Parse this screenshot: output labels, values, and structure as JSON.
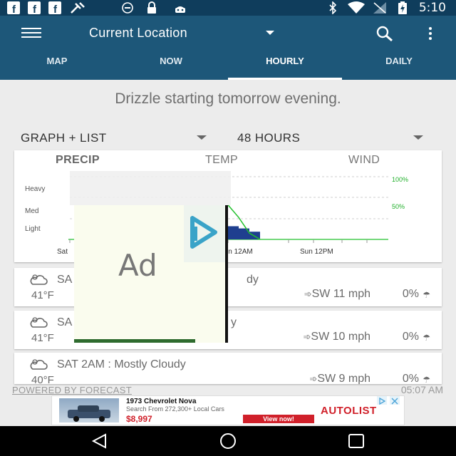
{
  "status_bar": {
    "time": "5:10",
    "left_icons": [
      "facebook-icon",
      "facebook-icon",
      "facebook-icon",
      "tool-icon",
      "info-icon",
      "lock-icon",
      "android-icon"
    ],
    "right_icons": [
      "bluetooth-icon",
      "wifi-icon",
      "signal-icon",
      "battery-charging-icon"
    ]
  },
  "app_bar": {
    "title": "Current Location",
    "color": "#1d5779"
  },
  "tabs": [
    {
      "label": "MAP",
      "active": false
    },
    {
      "label": "NOW",
      "active": false
    },
    {
      "label": "HOURLY",
      "active": true
    },
    {
      "label": "DAILY",
      "active": false
    }
  ],
  "summary": "Drizzle starting tomorrow evening.",
  "view_dropdown": "GRAPH + LIST",
  "range_dropdown": "48 HOURS",
  "chart_tabs": [
    {
      "label": "PRECIP",
      "active": true
    },
    {
      "label": "TEMP",
      "active": false
    },
    {
      "label": "WIND",
      "active": false
    }
  ],
  "chart_data": {
    "type": "area",
    "y_labels": [
      "Heavy",
      "Med",
      "Light"
    ],
    "right_labels": [
      "100%",
      "50%"
    ],
    "x_labels": [
      "Sat",
      "Sun 12AM",
      "Sun 12PM"
    ],
    "series": [
      {
        "color": "#1f3f8f",
        "values": [
          0.6,
          0.5,
          0.35,
          0.0
        ]
      },
      {
        "color": "#22c02c",
        "values": [
          0.55,
          0.35,
          0.1,
          0.0
        ]
      }
    ]
  },
  "hour_rows": [
    {
      "title": "SA",
      "title_tail": "dy",
      "temp": "41°F",
      "wind": "SW 11 mph",
      "precip": "0%"
    },
    {
      "title": "SA",
      "title_tail": "y",
      "temp": "41°F",
      "wind": "SW 10 mph",
      "precip": "0%"
    },
    {
      "title": "SAT 2AM : Mostly Cloudy",
      "title_tail": "",
      "temp": "40°F",
      "wind": "SW 9 mph",
      "precip": "0%"
    }
  ],
  "footer": {
    "powered": "POWERED BY FORECAST",
    "updated": "05:07 AM"
  },
  "ad_popup": {
    "text": "Ad"
  },
  "ad_banner": {
    "title": "1973 Chevrolet Nova",
    "subtitle": "Search From 272,300+ Local Cars",
    "price": "$8,997",
    "cta": "View now!",
    "brand": "AUTOLIST"
  },
  "nav_icons": [
    "back-icon",
    "home-icon",
    "recents-icon"
  ]
}
